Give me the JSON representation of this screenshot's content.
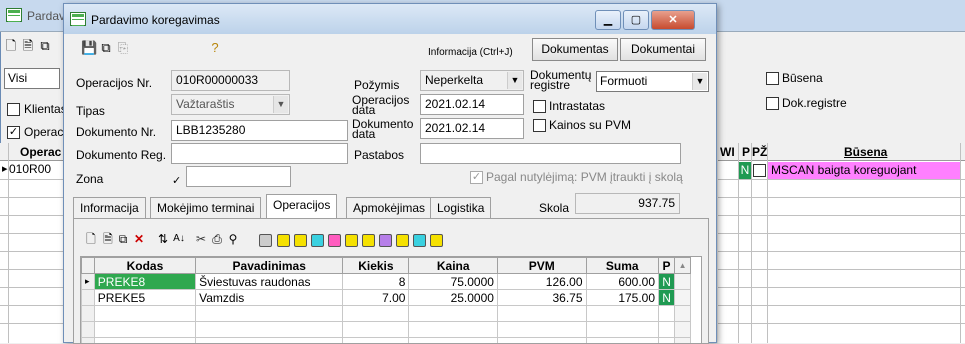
{
  "colors": {
    "accent_green": "#1f9a52",
    "status_pink": "#ff80ff",
    "selected_cell_green": "#2fa84f",
    "close_red": "#c74b2f"
  },
  "background_window": {
    "title": "Pardav",
    "filter_value": "Visi",
    "klientas_label": "Klientas",
    "operac_checkbox_label": "Operac",
    "grid_first_col_header": "Operac",
    "grid_first_row_value": "010R00",
    "busena_checkbox_label": "Būsena",
    "dok_registre_checkbox_label": "Dok.registre",
    "col_headers": [
      "WI",
      "P",
      "PŽ",
      "Būsena"
    ],
    "row": {
      "p_value": "N",
      "busena_value": "MSCAN baigta koreguojant"
    }
  },
  "dialog": {
    "title": "Pardavimo koregavimas",
    "info_hint": "Informacija (Ctrl+J)",
    "btn_dokumentas": "Dokumentas",
    "btn_dokumentai": "Dokumentai",
    "fields": {
      "operacijos_nr_label": "Operacijos Nr.",
      "operacijos_nr_value": "010R00000033",
      "tipas_label": "Tipas",
      "tipas_value": "Važtaraštis",
      "dokumento_nr_label": "Dokumento Nr.",
      "dokumento_nr_value": "LBB1235280",
      "dokumento_reg_label": "Dokumento Reg.",
      "dokumento_reg_value": "",
      "zona_label": "Zona",
      "zona_value": "",
      "pozymis_label": "Požymis",
      "pozymis_value": "Neperkelta",
      "operacijos_data_label": "Operacijos data",
      "operacijos_data_value": "2021.02.14",
      "dokumento_data_label": "Dokumento data",
      "dokumento_data_value": "2021.02.14",
      "pastabos_label": "Pastabos",
      "pastabos_value": "",
      "dokumentu_registre_label": "Dokumentų registre",
      "dokumentu_registre_value": "Formuoti",
      "intrastatas_label": "Intrastatas",
      "kainos_su_pvm_label": "Kainos su PVM",
      "pvm_skola_label": "Pagal nutylėjimą: PVM įtraukti į skolą",
      "skola_label": "Skola",
      "skola_value": "937.75"
    },
    "tabs": [
      "Informacija",
      "Mokėjimo terminai",
      "Operacijos",
      "Apmokėjimas",
      "Logistika"
    ],
    "active_tab": "Operacijos",
    "table": {
      "headers": [
        "Kodas",
        "Pavadinimas",
        "Kiekis",
        "Kaina",
        "PVM",
        "Suma",
        "P"
      ],
      "rows": [
        [
          "PREKE8",
          "Šviestuvas raudonas",
          "8",
          "75.0000",
          "126.00",
          "600.00",
          "N"
        ],
        [
          "PREKE5",
          "Vamzdis",
          "7.00",
          "25.0000",
          "36.75",
          "175.00",
          "N"
        ]
      ]
    }
  }
}
